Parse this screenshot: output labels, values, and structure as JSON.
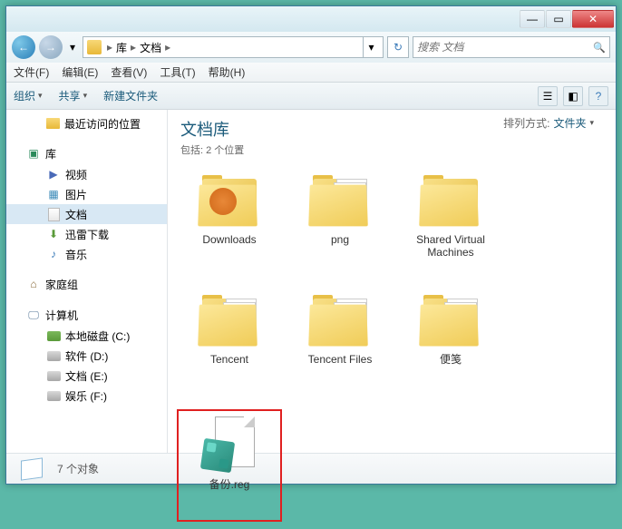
{
  "titlebar": {
    "min": "—",
    "max": "▭",
    "close": "✕"
  },
  "nav": {
    "back": "←",
    "forward": "→",
    "dropdown": "▾"
  },
  "breadcrumb": {
    "sep": "▸",
    "items": [
      "库",
      "文档"
    ],
    "dropdown": "▾"
  },
  "refresh": "↻",
  "search": {
    "placeholder": "搜索 文档",
    "icon": "🔍"
  },
  "menubar": [
    "文件(F)",
    "编辑(E)",
    "查看(V)",
    "工具(T)",
    "帮助(H)"
  ],
  "toolbar": {
    "organize": "组织",
    "share": "共享",
    "newfolder": "新建文件夹",
    "chev": "▾"
  },
  "library": {
    "title": "文档库",
    "subtitle": "包括: 2 个位置"
  },
  "sort": {
    "label": "排列方式:",
    "value": "文件夹",
    "chev": "▾"
  },
  "sidebar": {
    "recent": "最近访问的位置",
    "lib": "库",
    "video": "视频",
    "picture": "图片",
    "document": "文档",
    "download": "迅雷下载",
    "music": "音乐",
    "homegroup": "家庭组",
    "computer": "计算机",
    "drives": [
      "本地磁盘 (C:)",
      "软件 (D:)",
      "文档 (E:)",
      "娱乐 (F:)"
    ]
  },
  "items": [
    {
      "label": "Downloads",
      "type": "folder",
      "deco": "dl"
    },
    {
      "label": "png",
      "type": "folder-papers"
    },
    {
      "label": "Shared Virtual Machines",
      "type": "folder"
    },
    {
      "label": "Tencent",
      "type": "folder-papers"
    },
    {
      "label": "Tencent Files",
      "type": "folder-papers"
    },
    {
      "label": "便笺",
      "type": "folder-papers"
    },
    {
      "label": "备份.reg",
      "type": "reg",
      "highlight": true
    }
  ],
  "status": {
    "text": "7 个对象"
  }
}
